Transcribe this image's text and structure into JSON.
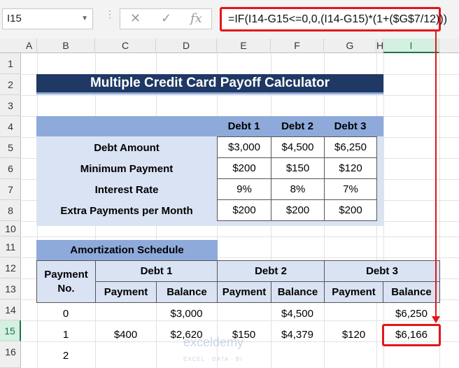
{
  "name_box": "I15",
  "formula": "=IF(I14-G15<=0,0,(I14-G15)*(1+($G$7/12)))",
  "formula_bar_icons": [
    "cancel-icon",
    "enter-check-icon",
    "function-fx-icon"
  ],
  "columns": [
    "A",
    "B",
    "C",
    "D",
    "E",
    "F",
    "G",
    "H",
    "I"
  ],
  "selected_column": "I",
  "rows": [
    "1",
    "2",
    "3",
    "4",
    "5",
    "6",
    "7",
    "8",
    "10",
    "11",
    "12",
    "13",
    "14",
    "15",
    "16"
  ],
  "selected_row": "15",
  "title": "Multiple Credit Card Payoff Calculator",
  "input_table": {
    "headers": [
      "Debt 1",
      "Debt 2",
      "Debt 3"
    ],
    "rows": [
      {
        "label": "Debt Amount",
        "values": [
          "$3,000",
          "$4,500",
          "$6,250"
        ]
      },
      {
        "label": "Minimum Payment",
        "values": [
          "$200",
          "$150",
          "$120"
        ]
      },
      {
        "label": "Interest Rate",
        "values": [
          "9%",
          "8%",
          "7%"
        ]
      },
      {
        "label": "Extra Payments per Month",
        "values": [
          "$200",
          "$200",
          "$200"
        ]
      }
    ]
  },
  "schedule": {
    "title": "Amortization Schedule",
    "payment_no_header": "Payment No.",
    "debt_headers": [
      "Debt 1",
      "Debt 2",
      "Debt 3"
    ],
    "sub_headers": [
      "Payment",
      "Balance",
      "Payment",
      "Balance",
      "Payment",
      "Balance"
    ],
    "rows": [
      {
        "no": "0",
        "cells": [
          "",
          "$3,000",
          "",
          "$4,500",
          "",
          "$6,250"
        ]
      },
      {
        "no": "1",
        "cells": [
          "$400",
          "$2,620",
          "$150",
          "$4,379",
          "$120",
          "$6,166"
        ]
      },
      {
        "no": "2",
        "cells": [
          "",
          "",
          "",
          "",
          "",
          ""
        ]
      }
    ]
  },
  "watermark": {
    "brand": "exceldemy",
    "tagline": "EXCEL · DATA · BI"
  },
  "highlight_color": "#e3161a",
  "title_color": "#1f3864",
  "header_fill": "#8eaadb",
  "label_fill": "#dae3f3"
}
